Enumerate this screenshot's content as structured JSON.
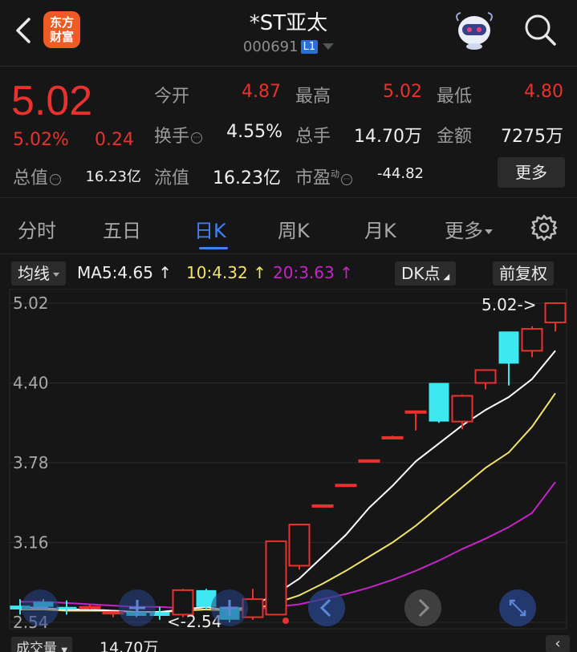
{
  "header": {
    "logo_text_line1": "东方",
    "logo_text_line2": "财富",
    "title": "*ST亚太",
    "code": "000691",
    "level": "L1"
  },
  "quote": {
    "price": "5.02",
    "change_pct": "5.02%",
    "change": "0.24",
    "open_label": "今开",
    "open": "4.87",
    "high_label": "最高",
    "high": "5.02",
    "low_label": "最低",
    "low": "4.80",
    "turnover_label": "换手",
    "turnover": "4.55%",
    "volume_label": "总手",
    "volume": "14.70万",
    "amount_label": "金额",
    "amount": "7275万",
    "mktcap_label": "总值",
    "mktcap": "16.23亿",
    "float_label": "流值",
    "float": "16.23亿",
    "pe_label": "市盈",
    "pe_sup": "动",
    "pe": "-44.82",
    "more_button": "更多"
  },
  "tabs": [
    "分时",
    "五日",
    "日K",
    "周K",
    "月K",
    "更多"
  ],
  "active_tab": 2,
  "indicator_bar": {
    "ma_selector": "均线",
    "ma5": "MA5:4.65",
    "ma10": "10:4.32",
    "ma20": "20:3.63",
    "arrow": "↑",
    "dk_button": "DK点",
    "adjust_button": "前复权"
  },
  "colors": {
    "up": "#e8322d",
    "down": "#3ee8f0",
    "ma5": "#ffffff",
    "ma10": "#f2e36a",
    "ma20": "#c624c8",
    "accent": "#3f82f5"
  },
  "chart_data": {
    "type": "candlestick",
    "y_ticks": [
      "5.02",
      "4.40",
      "3.78",
      "3.16",
      "2.54"
    ],
    "ylim": [
      2.54,
      5.02
    ],
    "max_label": "5.02->",
    "min_label": "<-2.54",
    "candles": [
      {
        "o": 2.67,
        "h": 2.72,
        "l": 2.6,
        "c": 2.64
      },
      {
        "o": 2.7,
        "h": 2.72,
        "l": 2.64,
        "c": 2.66
      },
      {
        "o": 2.66,
        "h": 2.71,
        "l": 2.6,
        "c": 2.64
      },
      {
        "o": 2.66,
        "h": 2.68,
        "l": 2.64,
        "c": 2.66
      },
      {
        "o": 2.62,
        "h": 2.62,
        "l": 2.58,
        "c": 2.62
      },
      {
        "o": 2.62,
        "h": 2.66,
        "l": 2.58,
        "c": 2.59
      },
      {
        "o": 2.62,
        "h": 2.66,
        "l": 2.56,
        "c": 2.59
      },
      {
        "o": 2.6,
        "h": 2.8,
        "l": 2.58,
        "c": 2.79
      },
      {
        "o": 2.79,
        "h": 2.8,
        "l": 2.64,
        "c": 2.66
      },
      {
        "o": 2.66,
        "h": 2.7,
        "l": 2.54,
        "c": 2.56
      },
      {
        "o": 2.58,
        "h": 2.8,
        "l": 2.56,
        "c": 2.72
      },
      {
        "o": 2.6,
        "h": 3.17,
        "l": 2.6,
        "c": 3.17
      },
      {
        "o": 2.98,
        "h": 3.3,
        "l": 2.95,
        "c": 3.3
      },
      {
        "o": 3.45,
        "h": 3.45,
        "l": 3.45,
        "c": 3.45
      },
      {
        "o": 3.61,
        "h": 3.61,
        "l": 3.61,
        "c": 3.61
      },
      {
        "o": 3.8,
        "h": 3.8,
        "l": 3.8,
        "c": 3.8
      },
      {
        "o": 3.98,
        "h": 3.99,
        "l": 3.97,
        "c": 3.98
      },
      {
        "o": 4.18,
        "h": 4.18,
        "l": 4.03,
        "c": 4.18
      },
      {
        "o": 4.4,
        "h": 4.4,
        "l": 4.09,
        "c": 4.1
      },
      {
        "o": 4.1,
        "h": 4.31,
        "l": 4.04,
        "c": 4.3
      },
      {
        "o": 4.4,
        "h": 4.5,
        "l": 4.35,
        "c": 4.5
      },
      {
        "o": 4.8,
        "h": 4.8,
        "l": 4.38,
        "c": 4.55
      },
      {
        "o": 4.65,
        "h": 4.84,
        "l": 4.6,
        "c": 4.82
      },
      {
        "o": 4.87,
        "h": 5.02,
        "l": 4.8,
        "c": 5.02
      }
    ],
    "ma5": [
      2.66,
      2.65,
      2.64,
      2.64,
      2.63,
      2.62,
      2.62,
      2.64,
      2.66,
      2.63,
      2.67,
      2.76,
      2.88,
      3.05,
      3.22,
      3.43,
      3.6,
      3.79,
      3.93,
      4.07,
      4.19,
      4.29,
      4.43,
      4.65
    ],
    "ma10": [
      2.64,
      2.64,
      2.63,
      2.63,
      2.63,
      2.62,
      2.62,
      2.63,
      2.64,
      2.63,
      2.64,
      2.69,
      2.75,
      2.84,
      2.94,
      3.05,
      3.16,
      3.29,
      3.44,
      3.59,
      3.74,
      3.86,
      4.06,
      4.32
    ],
    "ma20": [
      2.7,
      2.7,
      2.69,
      2.68,
      2.67,
      2.66,
      2.66,
      2.65,
      2.64,
      2.64,
      2.64,
      2.66,
      2.68,
      2.72,
      2.76,
      2.81,
      2.87,
      2.94,
      3.02,
      3.11,
      3.19,
      3.28,
      3.39,
      3.63
    ]
  },
  "bottom": {
    "volume_selector": "成交量",
    "volume_value": "14.70万",
    "collapse": "‹"
  }
}
